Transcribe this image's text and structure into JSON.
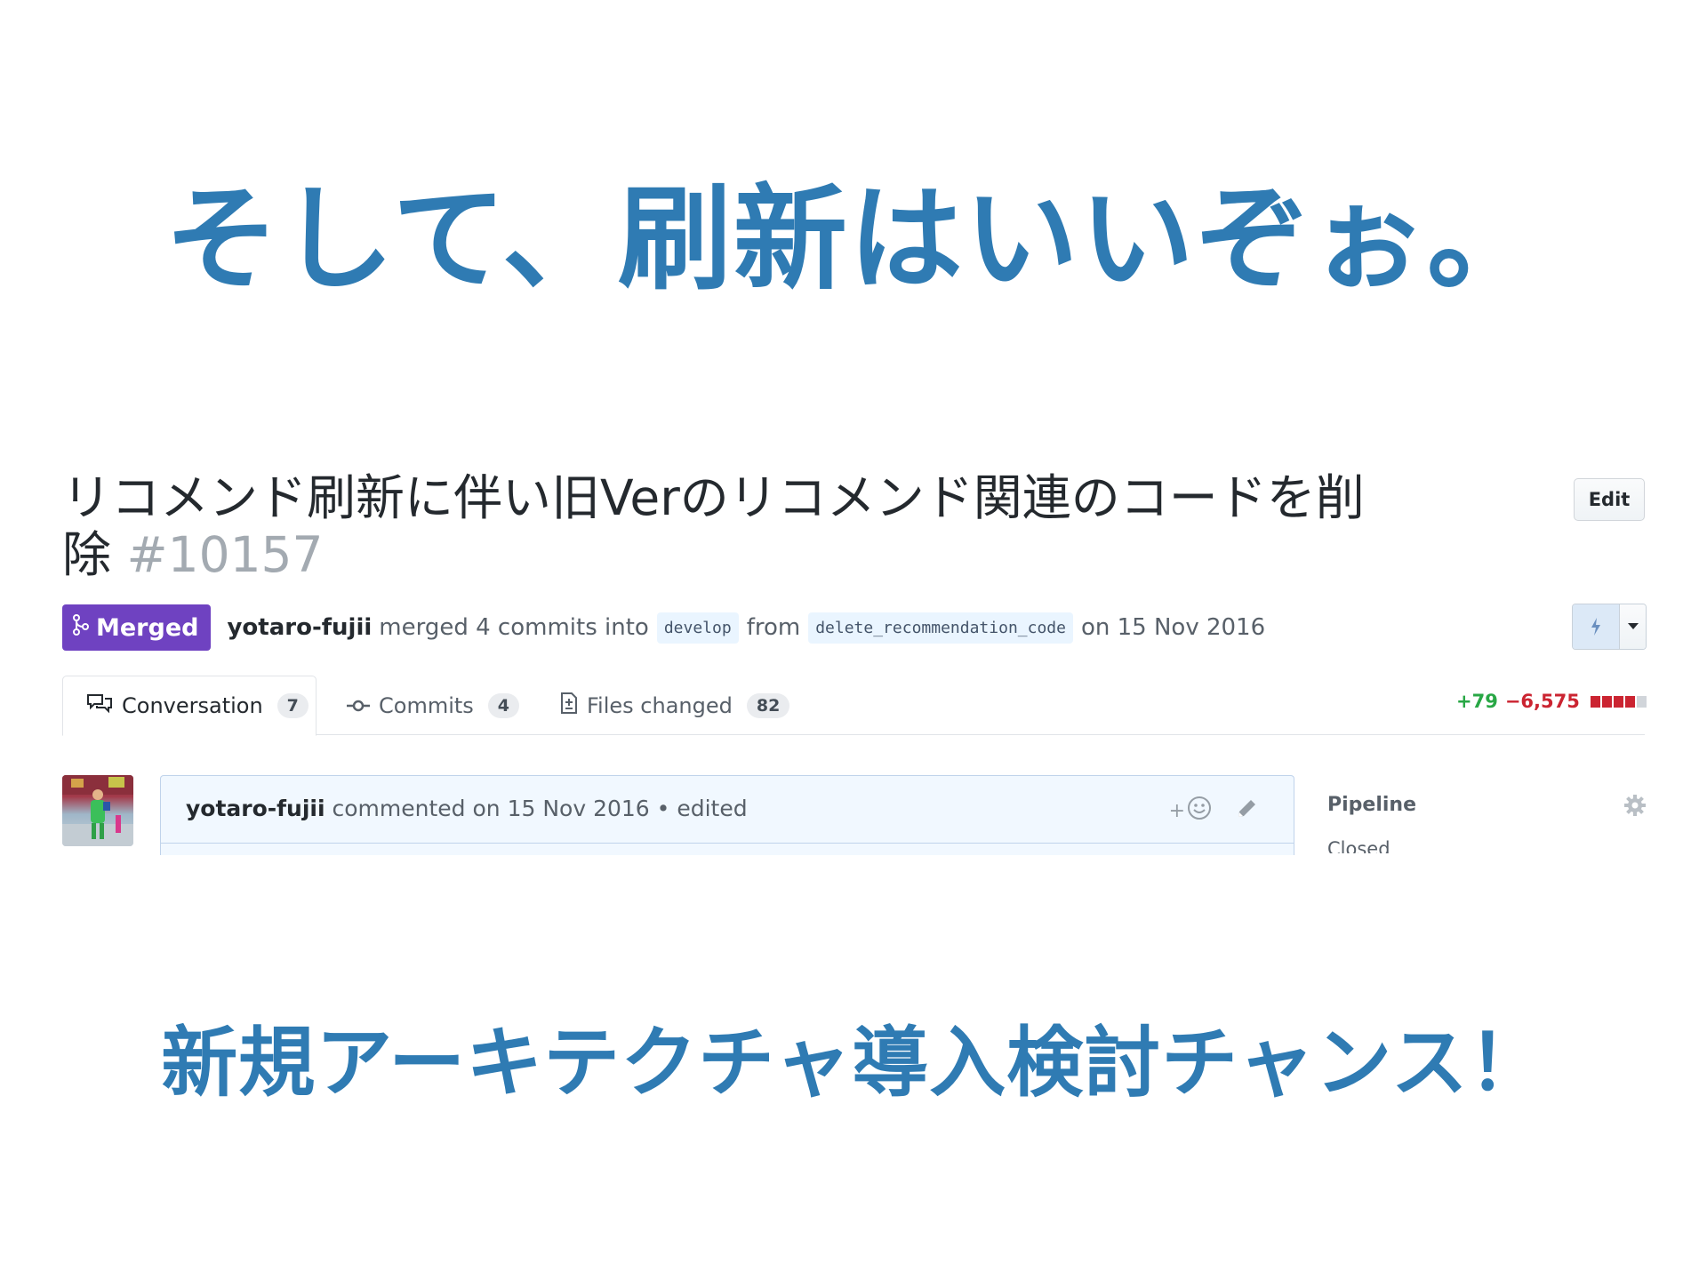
{
  "headline_top": "そして、刷新はいいぞぉ。",
  "headline_bottom": "新規アーキテクチャ導入検討チャンス！",
  "pr": {
    "title": "リコメンド刷新に伴い旧Verのリコメンド関連のコードを削除",
    "number": "#10157",
    "edit_label": "Edit",
    "status": "Merged",
    "author": "yotaro-fujii",
    "merged_text": "merged 4 commits into",
    "base_branch": "develop",
    "from_text": "from",
    "head_branch": "delete_recommendation_code",
    "date_text": "on 15 Nov 2016"
  },
  "tabs": [
    {
      "label": "Conversation",
      "count": "7"
    },
    {
      "label": "Commits",
      "count": "4"
    },
    {
      "label": "Files changed",
      "count": "82"
    }
  ],
  "diffstat": {
    "additions": "+79",
    "deletions": "−6,575"
  },
  "comment": {
    "author": "yotaro-fujii",
    "text": "commented on 15 Nov 2016 • edited",
    "reaction_plus": "+"
  },
  "sidebar": {
    "label": "Pipeline",
    "value": "Closed"
  },
  "colors": {
    "headline": "#2f7bb3",
    "merged": "#6f42c1",
    "additions": "#28a745",
    "deletions": "#cb2431"
  },
  "icons": [
    "merge-icon",
    "bolt-icon",
    "caret-down-icon",
    "comment-discussion-icon",
    "commit-icon",
    "file-diff-icon",
    "smiley-icon",
    "pencil-icon",
    "gear-icon"
  ]
}
